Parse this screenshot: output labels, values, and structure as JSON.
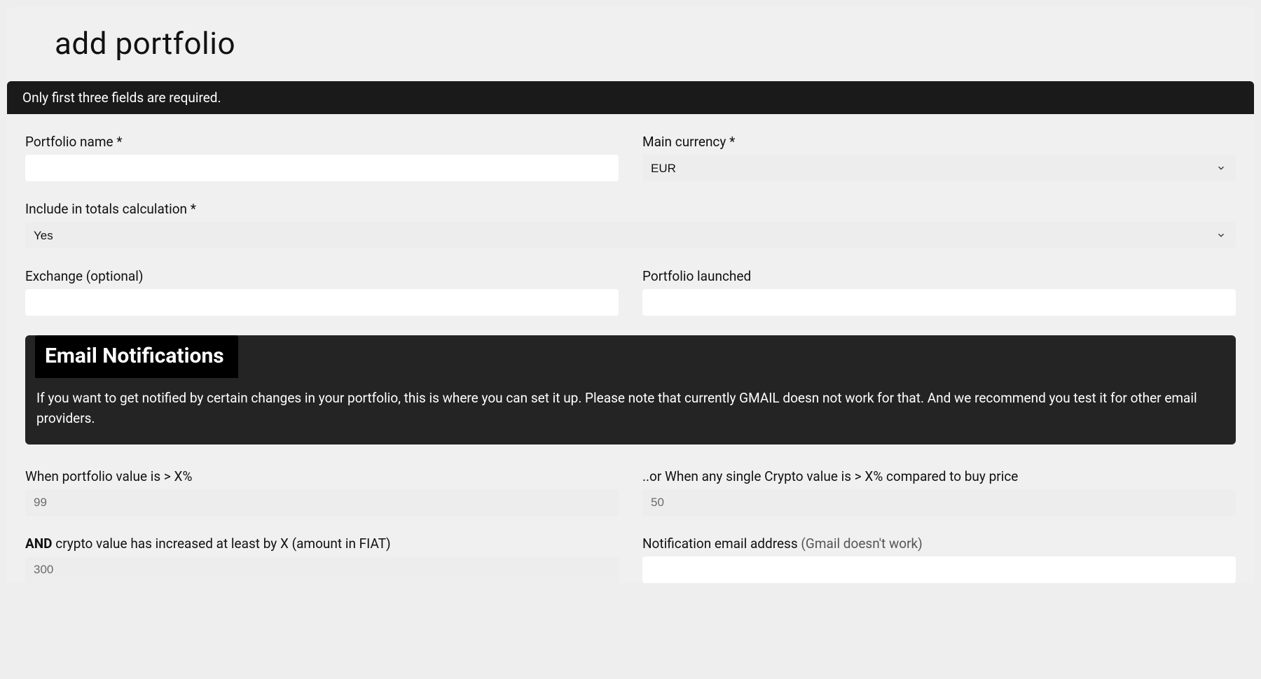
{
  "page": {
    "title": "add portfolio"
  },
  "notice": "Only first three fields are required.",
  "fields": {
    "portfolio_name": {
      "label": "Portfolio name *",
      "value": ""
    },
    "main_currency": {
      "label": "Main currency *",
      "value": "EUR"
    },
    "include_totals": {
      "label": "Include in totals calculation *",
      "value": "Yes"
    },
    "exchange": {
      "label": "Exchange (optional)",
      "value": ""
    },
    "launched": {
      "label": "Portfolio launched",
      "value": ""
    }
  },
  "notifications": {
    "heading": "Email Notifications",
    "description": "If you want to get notified by certain changes in your portfolio, this is where you can set it up. Please note that currently GMAIL doesn not work for that. And we recommend you test it for other email providers.",
    "value_gt": {
      "label": "When portfolio value is > X%",
      "placeholder": "99"
    },
    "single_gt": {
      "label": "..or When any single Crypto value is > X% compared to buy price",
      "placeholder": "50"
    },
    "and_increase": {
      "label_prefix": "AND",
      "label_rest": " crypto value has increased at least by X (amount in FIAT)",
      "placeholder": "300"
    },
    "email": {
      "label_main": "Notification email address ",
      "label_hint": "(Gmail doesn't work)",
      "value": ""
    }
  }
}
